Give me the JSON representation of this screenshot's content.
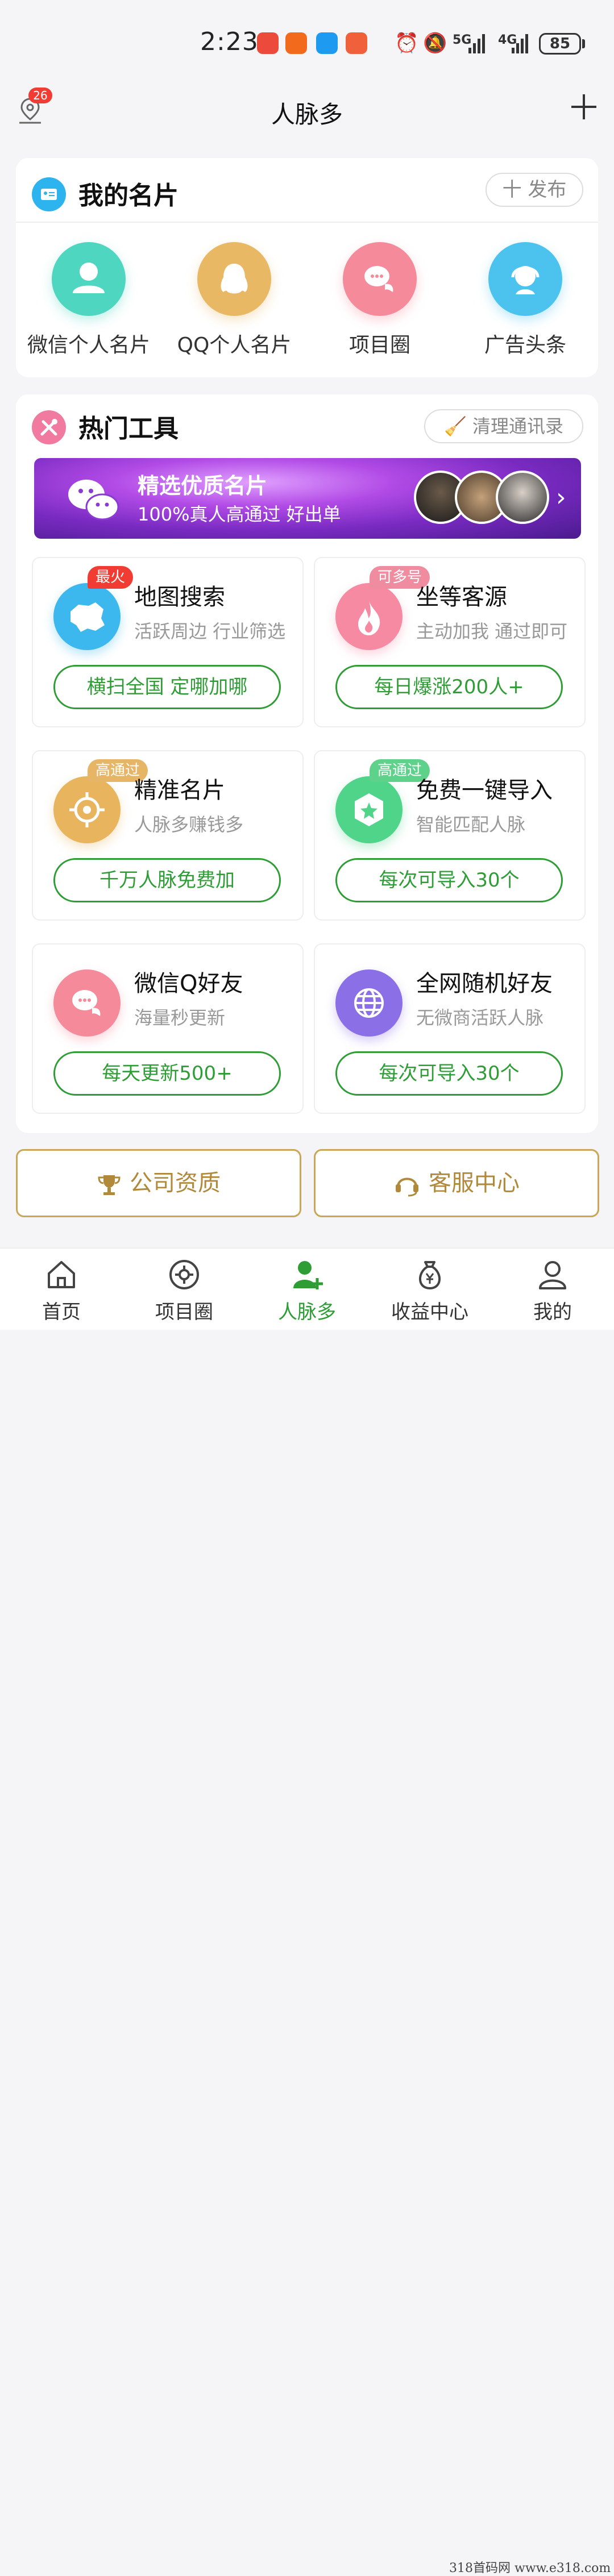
{
  "status_bar": {
    "time": "2:23",
    "net1": "5G",
    "net2": "4G",
    "battery": "85"
  },
  "header": {
    "location_badge": "26",
    "title": "人脉多"
  },
  "my_card": {
    "title": "我的名片",
    "publish_button": "十 发布",
    "items": [
      {
        "label": "微信个人名片",
        "color": "#4fd6c0",
        "icon": "person-icon"
      },
      {
        "label": "QQ个人名片",
        "color": "#e9b864",
        "icon": "penguin-icon"
      },
      {
        "label": "项目圈",
        "color": "#f58a9a",
        "icon": "chat-icon"
      },
      {
        "label": "广告头条",
        "color": "#4cc3ee",
        "icon": "headset-icon"
      }
    ]
  },
  "hot_tools": {
    "title": "热门工具",
    "clean_button": "清理通讯录",
    "banner": {
      "title": "精选优质名片",
      "subtitle": "100%真人高通过 好出单"
    },
    "tools": [
      {
        "title": "地图搜索",
        "sub": "活跃周边 行业筛选",
        "button": "横扫全国 定哪加哪",
        "tag": "最火",
        "tag_color": "#f03c32",
        "color": "#3cb8ee",
        "icon": "map-icon"
      },
      {
        "title": "坐等客源",
        "sub": "主动加我 通过即可",
        "button": "每日爆涨200人+",
        "tag": "可多号",
        "tag_color": "#f08ca0",
        "color": "#f58aa2",
        "icon": "flame-icon"
      },
      {
        "title": "精准名片",
        "sub": "人脉多赚钱多",
        "button": "千万人脉免费加",
        "tag": "高通过",
        "tag_color": "#e6b566",
        "color": "#e8b45e",
        "icon": "target-icon"
      },
      {
        "title": "免费一键导入",
        "sub": "智能匹配人脉",
        "button": "每次可导入30个",
        "tag": "高通过",
        "tag_color": "#5ed28a",
        "color": "#4fd48a",
        "icon": "star-hexagon-icon"
      },
      {
        "title": "微信Q好友",
        "sub": "海量秒更新",
        "button": "每天更新500+",
        "tag": "",
        "tag_color": "",
        "color": "#f58a9a",
        "icon": "chat-icon"
      },
      {
        "title": "全网随机好友",
        "sub": "无微商活跃人脉",
        "button": "每次可导入30个",
        "tag": "",
        "tag_color": "",
        "color": "#8b6fe6",
        "icon": "globe-icon"
      }
    ]
  },
  "bottom_buttons": {
    "company": "公司资质",
    "service": "客服中心"
  },
  "tabbar": {
    "items": [
      {
        "label": "首页",
        "icon": "home-icon"
      },
      {
        "label": "项目圈",
        "icon": "gear-circle-icon"
      },
      {
        "label": "人脉多",
        "icon": "add-person-icon"
      },
      {
        "label": "收益中心",
        "icon": "money-bag-icon"
      },
      {
        "label": "我的",
        "icon": "user-icon"
      }
    ],
    "active_index": 2
  },
  "watermark": "318首码网 www.e318.com"
}
